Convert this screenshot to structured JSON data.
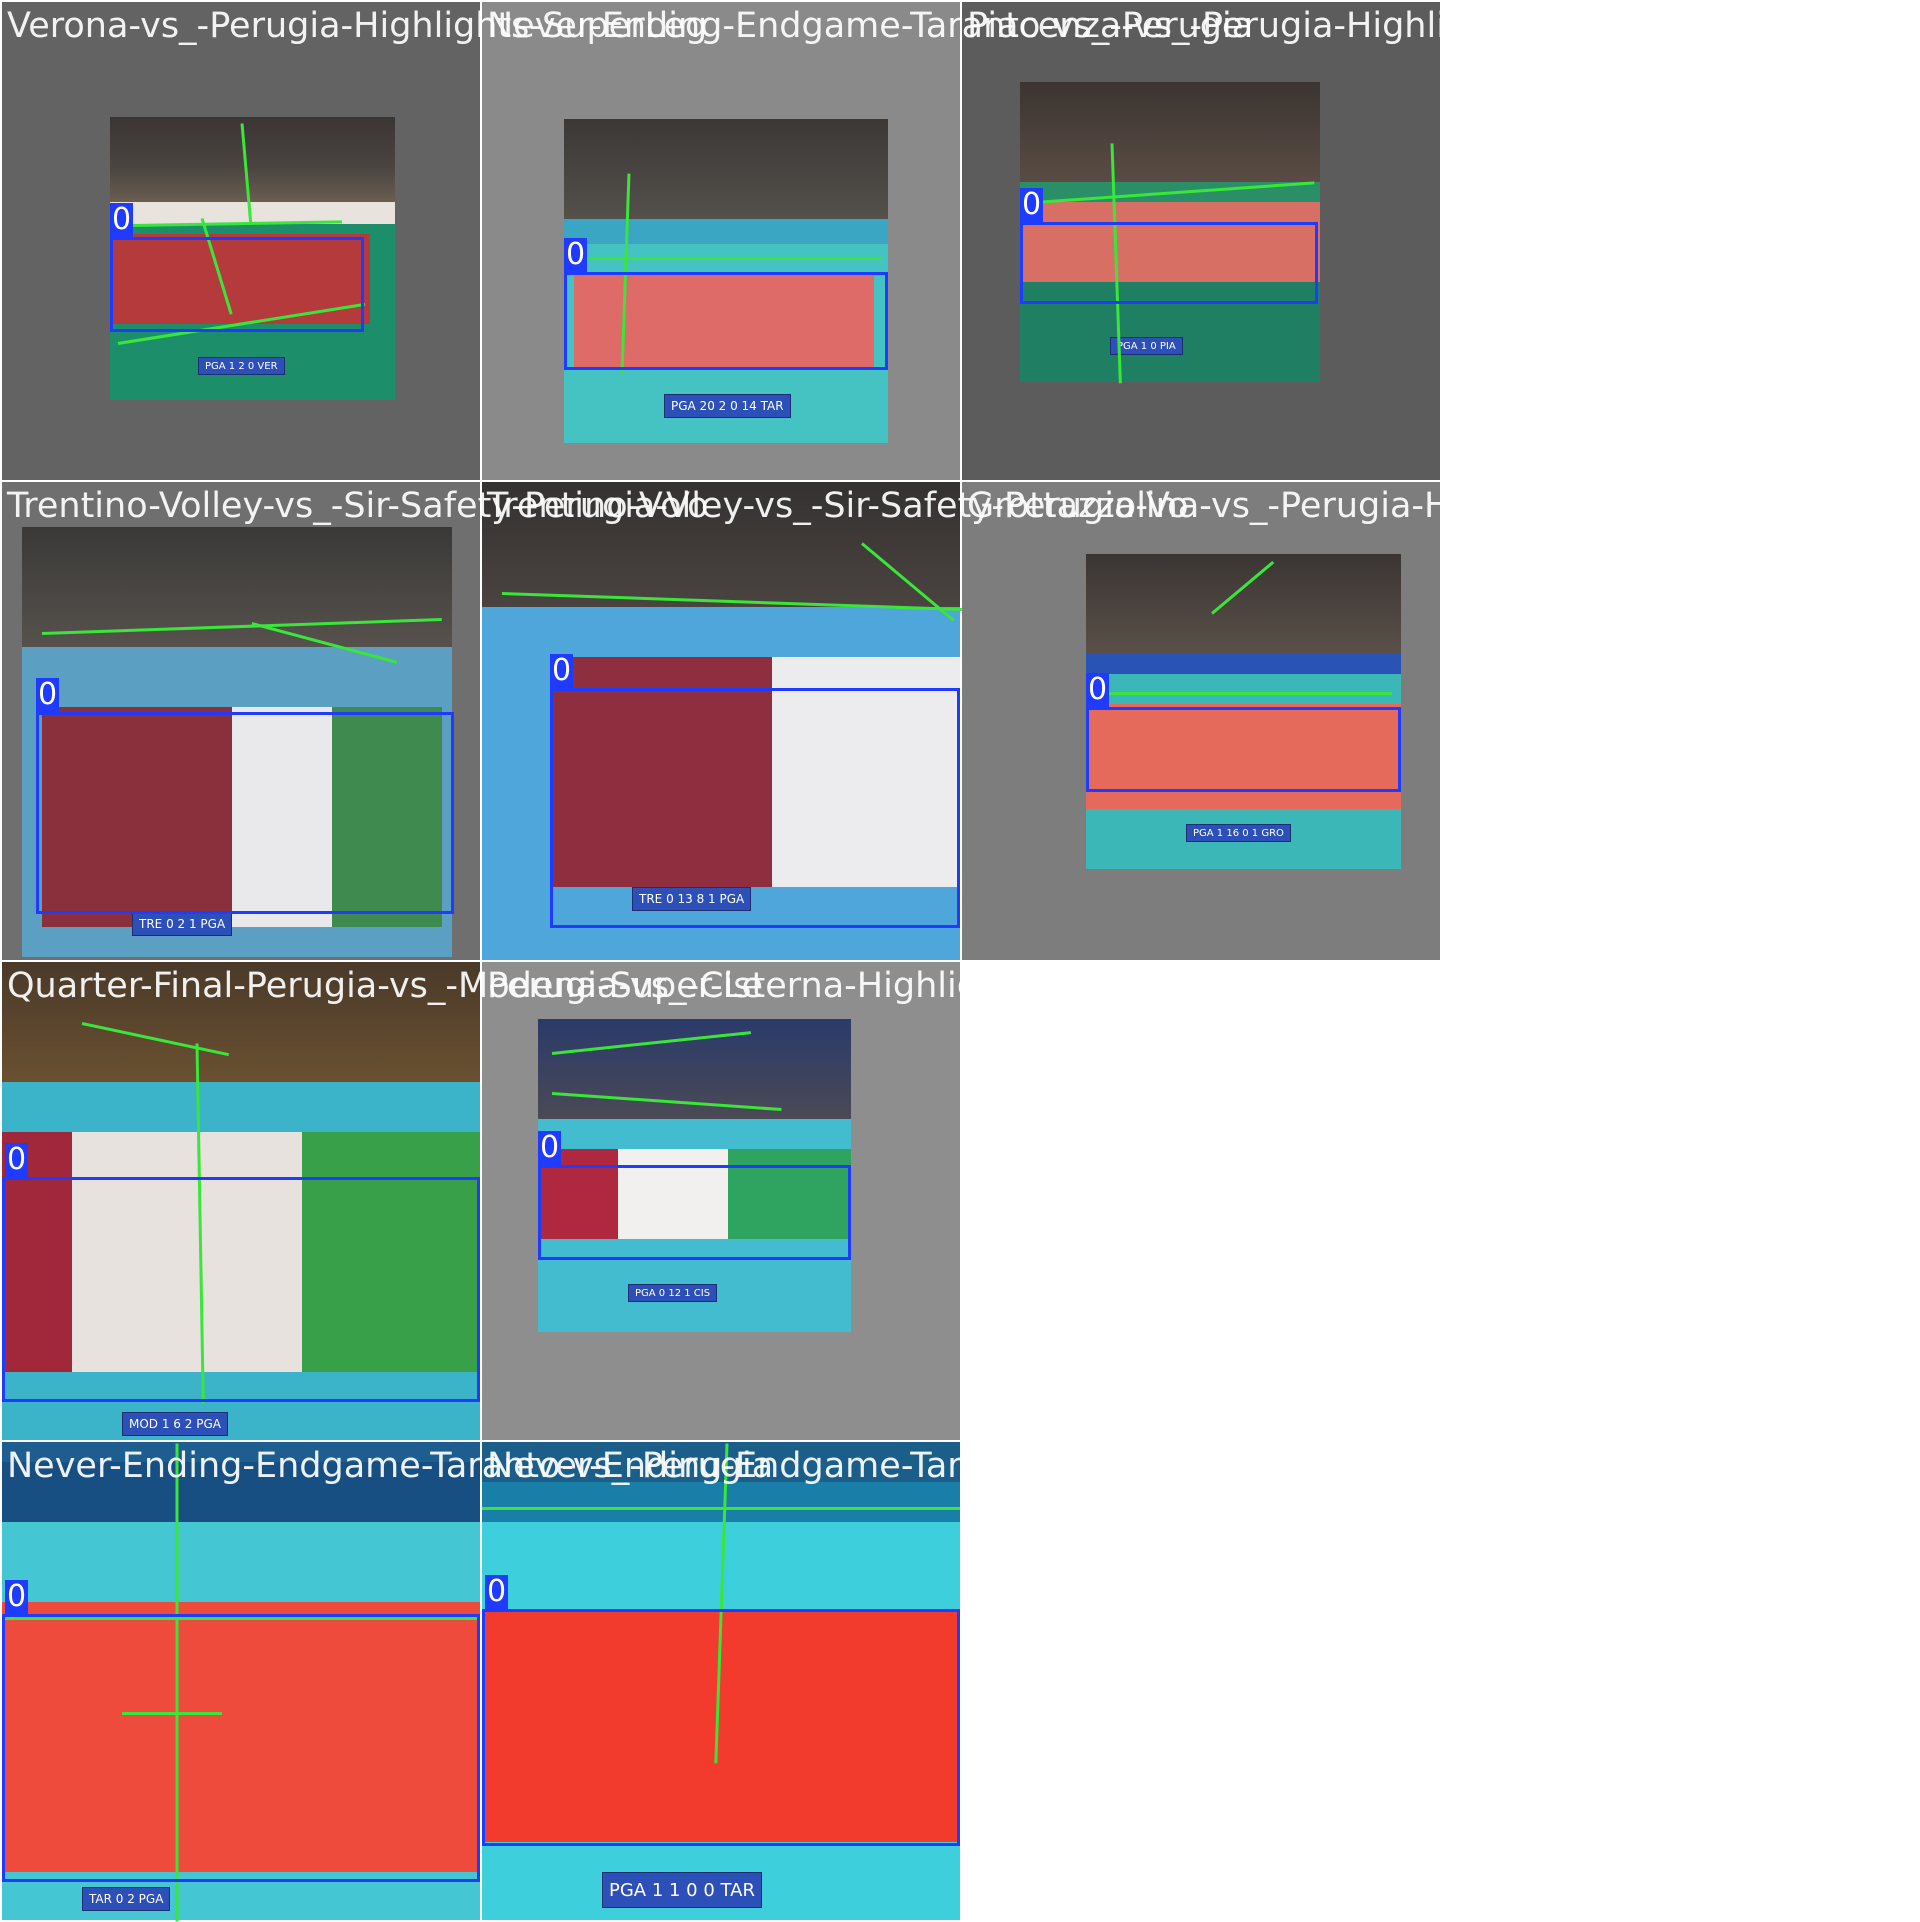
{
  "mosaic": {
    "tiles": [
      {
        "title": "Verona-vs_-Perugia-Highlights-SuperLeg",
        "label": "0",
        "scoreboard": "PGA  1  2  0  VER",
        "bg": "#636363"
      },
      {
        "title": "Never-Ending-Endgame-Taranto-vs_-Perugia",
        "label": "0",
        "scoreboard": "PGA  20  2  0  14  TAR",
        "bg": "#8a8a8a"
      },
      {
        "title": "Piacenza-vs_-Perugia-Highlights-SuperLeg",
        "label": "0",
        "scoreboard": "PGA  1  0  PIA",
        "bg": "#5c5c5c"
      },
      {
        "title": "Trentino-Volley-vs_-Sir-Safety-Perugia-Vo",
        "label": "0",
        "scoreboard": "TRE  0  2  1  PGA",
        "bg": "#6f6f6f"
      },
      {
        "title": "Trentino-Volley-vs_-Sir-Safety-Perugia-Vo",
        "label": "0",
        "scoreboard": "TRE  0  13  8  1  PGA",
        "bg": "#8c8c8c"
      },
      {
        "title": "Grottazzolina-vs_-Perugia-Highlights-Sup",
        "label": "0",
        "scoreboard": "PGA  1  16  0  1  GRO",
        "bg": "#7d7d7d"
      },
      {
        "title": "Quarter-Final-Perugia-vs_-Modena-Super-Le",
        "label": "0",
        "scoreboard": "MOD  1  6  2  PGA",
        "bg": "#4a4a4a"
      },
      {
        "title": "Perugia-vs_-Cisterna-Highlights-SuperLeg",
        "label": "0",
        "scoreboard": "PGA  0  12  1  CIS",
        "bg": "#8e8e8e"
      },
      {
        "title": "Never-Ending-Endgame-Taranto-vs_-Perugia",
        "label": "0",
        "scoreboard": "TAR  0  2  PGA",
        "bg": "#5f5f5f"
      },
      {
        "title": "Never-Ending-Endgame-Taranto-vs_-Perugia",
        "label": "0",
        "scoreboard": "PGA  1  1  0  0  TAR",
        "bg": "#5f5f5f"
      }
    ]
  }
}
